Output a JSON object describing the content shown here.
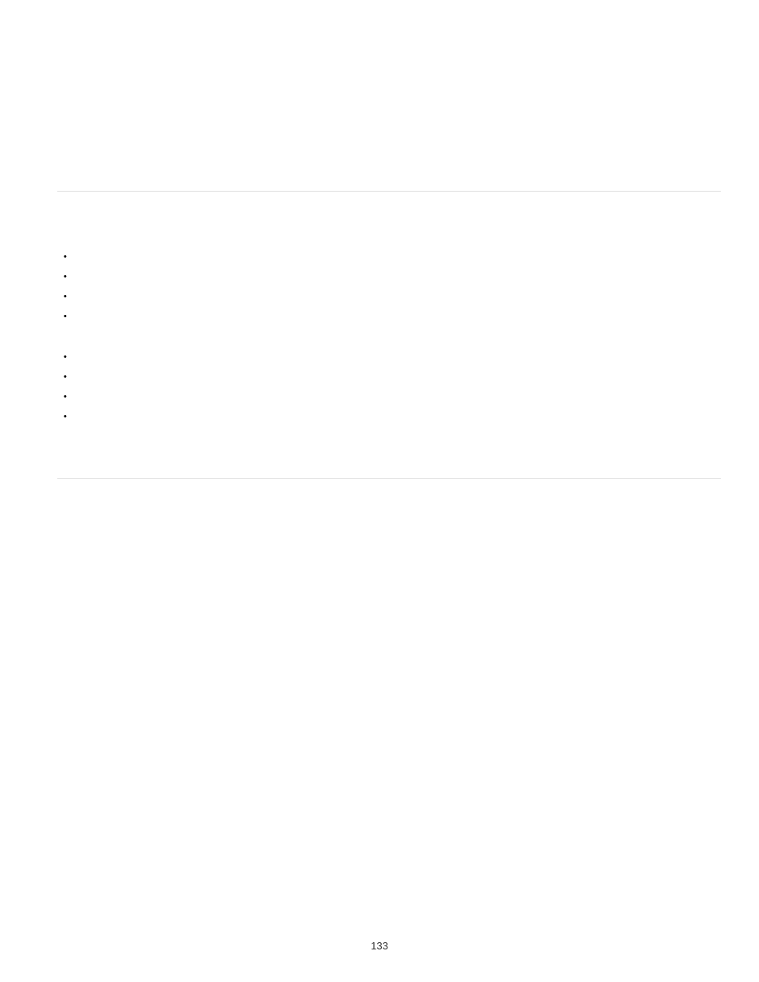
{
  "bullets_group_1": [
    {
      "text": ""
    },
    {
      "text": ""
    },
    {
      "text": ""
    },
    {
      "text": ""
    }
  ],
  "bullets_group_2": [
    {
      "text": ""
    },
    {
      "text": ""
    },
    {
      "text": ""
    },
    {
      "text": ""
    }
  ],
  "page_number": "133"
}
